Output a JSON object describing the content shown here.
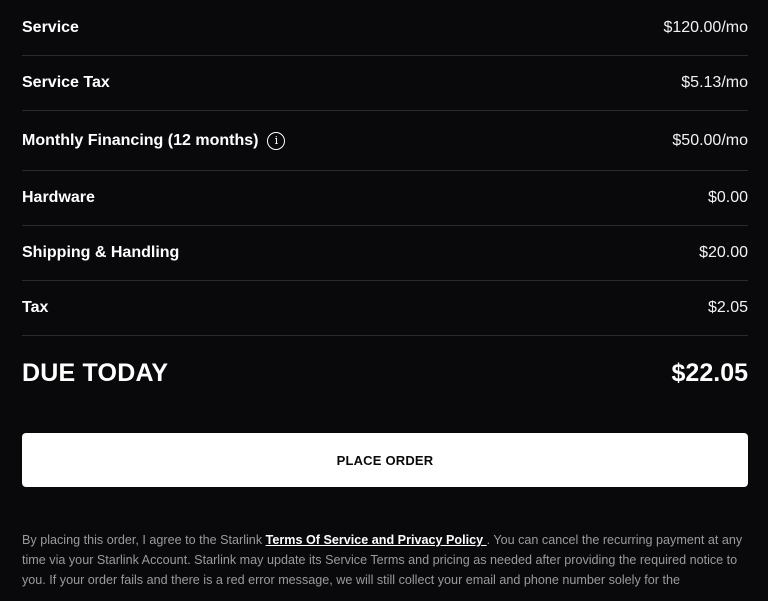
{
  "order_summary": {
    "rows": [
      {
        "label": "Service",
        "value": "$120.00/mo"
      },
      {
        "label": "Service Tax",
        "value": "$5.13/mo"
      },
      {
        "label": "Monthly Financing (12 months)",
        "value": "$50.00/mo",
        "icon": "info-icon"
      },
      {
        "label": "Hardware",
        "value": "$0.00"
      },
      {
        "label": "Shipping & Handling",
        "value": "$20.00"
      },
      {
        "label": "Tax",
        "value": "$2.05"
      }
    ],
    "info_icon_glyph": "i",
    "due_today": {
      "label": "DUE TODAY",
      "value": "$22.05"
    }
  },
  "place_order": {
    "label": "PLACE ORDER"
  },
  "legal": {
    "prefix": "By placing this order, I agree to the Starlink ",
    "link_text": "Terms Of Service and Privacy Policy ",
    "suffix": ". You can cancel the recurring payment at any time via your Starlink Account. Starlink may update its Service Terms and pricing as needed after providing the required notice to you. If your order fails and there is a red error message, we will still collect your email and phone number solely for the"
  },
  "colors": {
    "background": "#09090b",
    "divider": "#2b2b2e",
    "button_bg": "#ffffff",
    "legal_text": "#9a9a9e"
  }
}
